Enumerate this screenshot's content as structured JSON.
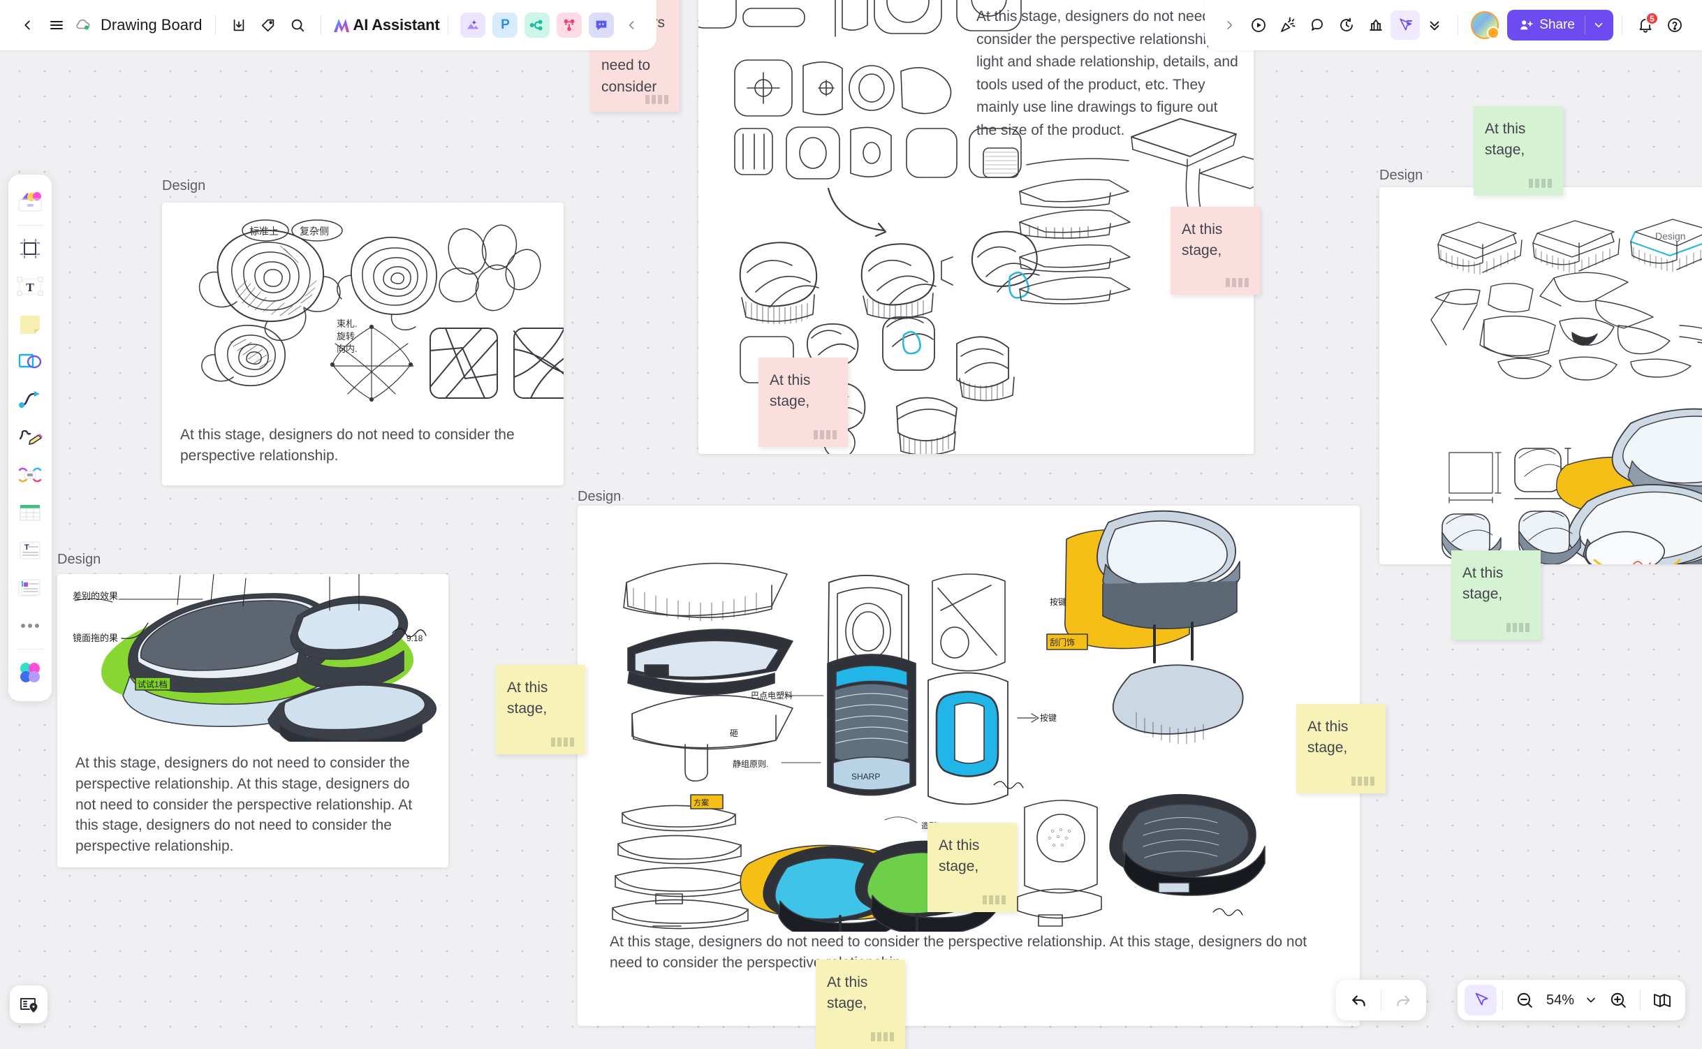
{
  "topbar": {
    "back_icon": "chevron-left-icon",
    "menu_icon": "hamburger-menu-icon",
    "cloud_icon": "cloud-saved-icon",
    "title": "Drawing Board",
    "download_icon": "download-icon",
    "tag_icon": "tag-icon",
    "search_icon": "search-icon",
    "ai_label": "AI Assistant",
    "app_chips": [
      {
        "name": "image-generate-chip",
        "glyph": "",
        "bg": "#ede4ff",
        "fg": "#8b5cf6"
      },
      {
        "name": "presentation-chip",
        "glyph": "P",
        "bg": "#d9ecff",
        "fg": "#2b8cf0"
      },
      {
        "name": "mindmap-chip",
        "glyph": "",
        "bg": "#cdf5e8",
        "fg": "#18bfa0"
      },
      {
        "name": "flowchart-chip",
        "glyph": "",
        "bg": "#ffdbe6",
        "fg": "#f2447b"
      },
      {
        "name": "comment-chip",
        "glyph": "",
        "bg": "#dcdcfb",
        "fg": "#5b5bf0"
      }
    ],
    "collapse_icon": "chevron-left-icon"
  },
  "topbar_right": {
    "expand_icon": "chevron-right-icon",
    "tools": [
      {
        "name": "present-play-icon"
      },
      {
        "name": "celebrate-icon"
      },
      {
        "name": "comment-bubble-icon"
      },
      {
        "name": "timer-icon"
      },
      {
        "name": "chart-icon"
      },
      {
        "name": "cursor-select-icon",
        "active": true
      },
      {
        "name": "chevron-double-down-icon"
      }
    ],
    "avatar": "user-avatar",
    "share_label": "Share",
    "share_caret": "chevron-down-icon",
    "notifications_icon": "bell-icon",
    "notifications_count": "5",
    "help_icon": "help-circle-icon"
  },
  "left_rail": [
    {
      "name": "sidebar-item-templates",
      "icon": "templates-icon"
    },
    {
      "name": "sidebar-item-frame",
      "icon": "frame-icon"
    },
    {
      "name": "sidebar-item-text",
      "icon": "text-T-icon"
    },
    {
      "name": "sidebar-item-sticky-note",
      "icon": "sticky-note-icon"
    },
    {
      "name": "sidebar-item-shapes",
      "icon": "shapes-icon"
    },
    {
      "name": "sidebar-item-connector",
      "icon": "curve-connector-icon"
    },
    {
      "name": "sidebar-item-pen",
      "icon": "pen-marker-icon"
    },
    {
      "name": "sidebar-item-mindmap",
      "icon": "mindmap-node-icon"
    },
    {
      "name": "sidebar-item-table",
      "icon": "table-icon"
    },
    {
      "name": "sidebar-item-text-block",
      "icon": "text-block-icon"
    },
    {
      "name": "sidebar-item-card",
      "icon": "card-stack-icon"
    },
    {
      "name": "sidebar-item-more",
      "icon": "more-dots-icon"
    },
    {
      "name": "sidebar-item-color-palette",
      "icon": "color-palette-icon"
    }
  ],
  "bottom_left": {
    "map_button": "map-locations-icon"
  },
  "bottom_right": {
    "undo_icon": "undo-arrow-icon",
    "redo_icon": "redo-arrow-icon",
    "cursor_icon": "cursor-select-icon",
    "zoom_out_icon": "zoom-out-icon",
    "zoom_level": "54%",
    "zoom_caret": "chevron-down-icon",
    "zoom_in_icon": "zoom-in-icon",
    "minimap_icon": "minimap-book-icon"
  },
  "board": {
    "cards": [
      {
        "id": "card-roses",
        "label": "Design",
        "body": "At this stage, designers do not need to consider the perspective relationship."
      },
      {
        "id": "card-forms",
        "label": "",
        "body": "At this stage, designers do not need to consider the perspective relationship, light and shade relationship, details, and tools used of the product, etc. They mainly use line drawings to figure out the size of the product."
      },
      {
        "id": "card-green-render",
        "label": "Design",
        "body": "At this stage, designers do not need to consider the perspective relationship. At this stage, designers do not need to consider the perspective relationship. At this stage, designers do not need to consider the perspective relationship."
      },
      {
        "id": "card-orange-render",
        "label": "Design",
        "inner_label": "Design",
        "body": ""
      },
      {
        "id": "card-bottom-center",
        "label": "Design",
        "body": "At this stage, designers do not need to consider the perspective relationship. At this stage, designers do not need to consider the perspective relationship."
      }
    ],
    "sticky_notes": [
      {
        "id": "note-pink-top",
        "color": "pink",
        "text": "stage, designers do not need to consider"
      },
      {
        "id": "note-pink-right",
        "color": "pink",
        "text": "At this stage,"
      },
      {
        "id": "note-pink-mid",
        "color": "pink",
        "text": "At this stage,"
      },
      {
        "id": "note-green-top",
        "color": "green",
        "text": "At this stage,"
      },
      {
        "id": "note-green-bottom",
        "color": "green",
        "text": "At this stage,"
      },
      {
        "id": "note-yellow-left",
        "color": "yellow",
        "text": "At this stage,"
      },
      {
        "id": "note-yellow-right",
        "color": "yellow",
        "text": "At this stage,"
      },
      {
        "id": "note-yellow-mid",
        "color": "yellow",
        "text": "At this stage,"
      },
      {
        "id": "note-yellow-low",
        "color": "yellow",
        "text": "At this stage,"
      }
    ]
  },
  "colors": {
    "accent": "#6c4cf1",
    "badge": "#ef3d3d",
    "sticky_pink": "#fbdfdf",
    "sticky_yellow": "#f6f2b8",
    "sticky_green": "#d5f2d3",
    "canvas": "#f0f0f2"
  }
}
